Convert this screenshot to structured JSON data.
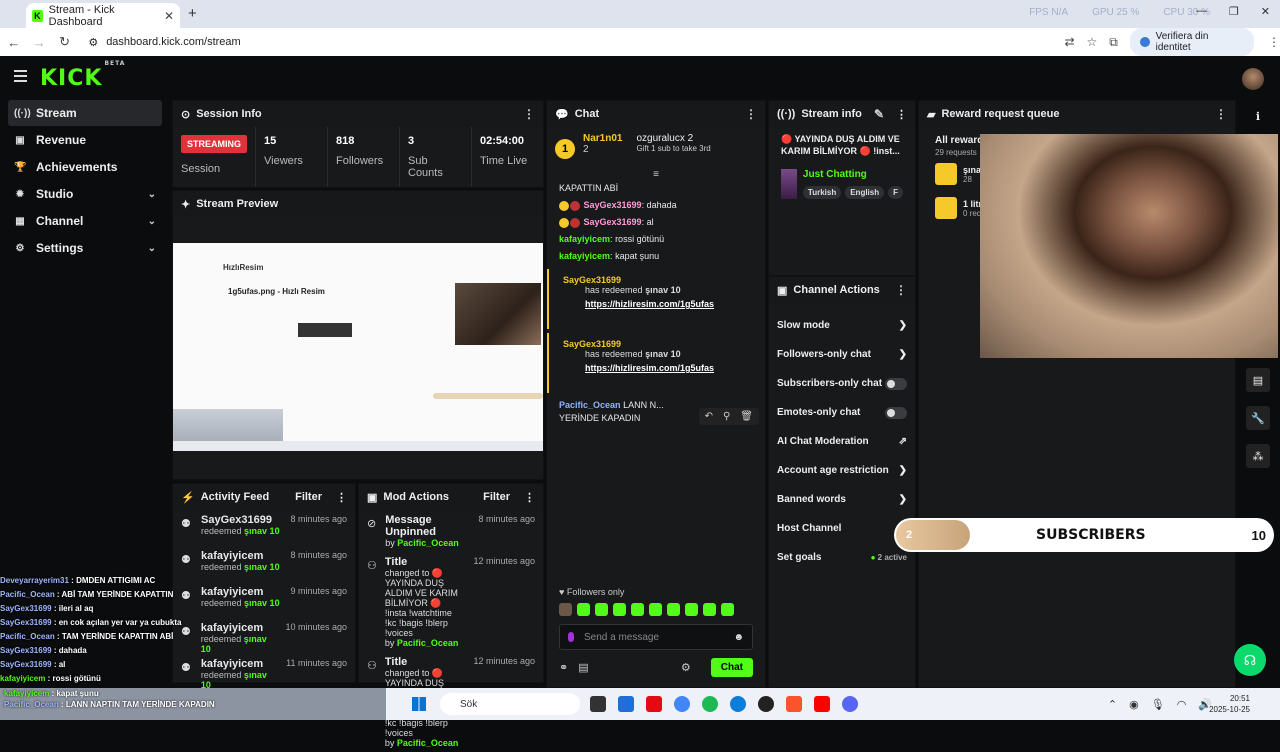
{
  "browser": {
    "tab_title": "Stream - Kick Dashboard",
    "url": "dashboard.kick.com/stream",
    "stats": [
      "FPS N/A",
      "GPU 25 %",
      "CPU 30 %"
    ],
    "profile_label": "Verifiera din identitet"
  },
  "app": {
    "logo": "KICK",
    "logo_tag": "BETA"
  },
  "sidebar": {
    "items": [
      {
        "label": "Stream",
        "icon": "broadcast-icon"
      },
      {
        "label": "Revenue",
        "icon": "wallet-icon"
      },
      {
        "label": "Achievements",
        "icon": "trophy-icon"
      },
      {
        "label": "Studio",
        "icon": "gear-icon"
      },
      {
        "label": "Channel",
        "icon": "grid-icon"
      },
      {
        "label": "Settings",
        "icon": "gear-icon"
      }
    ]
  },
  "session": {
    "title": "Session Info",
    "status": "STREAMING",
    "status_label": "Session",
    "viewers": {
      "value": "15",
      "label": "Viewers"
    },
    "followers": {
      "value": "818",
      "label": "Followers"
    },
    "subs": {
      "value": "3",
      "label": "Sub Counts"
    },
    "time": {
      "value": "02:54:00",
      "label": "Time Live"
    }
  },
  "preview": {
    "title": "Stream Preview",
    "site": "HızlıResim",
    "page_title": "1g5ufas.png - Hızlı Resim"
  },
  "activity": {
    "title": "Activity Feed",
    "filter": "Filter",
    "items": [
      {
        "name": "SayGex31699",
        "action": "redeemed",
        "reward": "şınav 10",
        "time": "8 minutes ago"
      },
      {
        "name": "kafayiyicem",
        "action": "redeemed",
        "reward": "şınav 10",
        "time": "8 minutes ago"
      },
      {
        "name": "kafayiyicem",
        "action": "redeemed",
        "reward": "şınav 10",
        "time": "9 minutes ago"
      },
      {
        "name": "kafayiyicem",
        "action": "redeemed",
        "reward": "şınav 10",
        "time": "10 minutes ago"
      },
      {
        "name": "kafayiyicem",
        "action": "redeemed",
        "reward": "şınav 10",
        "time": "11 minutes ago"
      }
    ]
  },
  "mod": {
    "title": "Mod Actions",
    "filter": "Filter",
    "items": [
      {
        "title": "Message Unpinned",
        "time": "8 minutes ago",
        "text": "",
        "by": "Pacific_Ocean"
      },
      {
        "title": "Title",
        "time": "12 minutes ago",
        "text": "changed to 🔴 YAYINDA DUŞ ALDIM VE KARIM BİLMİYOR 🔴 !insta !watchtime !kc !bagis !blerp !voices",
        "by": "Pacific_Ocean"
      },
      {
        "title": "Title",
        "time": "12 minutes ago",
        "text": "changed to 🔴 YAYINDA DUŞ ALDIM VE NARİN BİLMİYOR 🔴 !insta !watchtime !kc !bagis !blerp !voices",
        "by": "Pacific_Ocean"
      }
    ]
  },
  "chat": {
    "title": "Chat",
    "pinned": {
      "rank": "1",
      "name": "Nar1n01",
      "count": "2",
      "gifter": "ozguralucx",
      "gifter_count": "2",
      "gift_text": "Gift 1 sub to take 3rd"
    },
    "lines": [
      {
        "name": "",
        "text": "KAPATTIN ABİ"
      },
      {
        "name": "SayGex31699",
        "text": "dahada"
      },
      {
        "name": "SayGex31699",
        "text": "al"
      },
      {
        "name": "kafayiyicem",
        "text": "rossi götünü"
      },
      {
        "name": "kafayiyicem",
        "text": "kapat şunu"
      }
    ],
    "redeems": [
      {
        "name": "SayGex31699",
        "label": "has redeemed",
        "reward": "şınav 10",
        "link": "https://hizliresim.com/1g5ufas"
      },
      {
        "name": "SayGex31699",
        "label": "has redeemed",
        "reward": "şınav 10",
        "link": "https://hizliresim.com/1g5ufas"
      },
      {
        "name": "SayGex31699",
        "label": "has redeemed",
        "reward": "şınav 10",
        "link": "https://hizliresim.com/1g5ufas"
      },
      {
        "name": "SayGex31699",
        "label": "has redeemed",
        "reward": "şınav 10",
        "link": "https://hizliresim.com/1g5ufas"
      }
    ],
    "pacific": {
      "name": "Pacific_Ocean",
      "text": "LANN N...",
      "text2": "YERİNDE KAPADIN"
    },
    "followers_only": "Followers only",
    "placeholder": "Send a message",
    "send": "Chat"
  },
  "stream_info": {
    "title": "Stream info",
    "stream_title": "🔴 YAYINDA DUŞ ALDIM VE KARIM BİLMİYOR 🔴 !inst...",
    "category": "Just Chatting",
    "tags": [
      "Turkish",
      "English",
      "F"
    ]
  },
  "channel_actions": {
    "title": "Channel Actions",
    "items": [
      {
        "label": "Slow mode",
        "type": "arrow"
      },
      {
        "label": "Followers-only chat",
        "type": "arrow"
      },
      {
        "label": "Subscribers-only chat",
        "type": "toggle"
      },
      {
        "label": "Emotes-only chat",
        "type": "toggle"
      },
      {
        "label": "AI Chat Moderation",
        "type": "link"
      },
      {
        "label": "Account age restriction",
        "type": "arrow"
      },
      {
        "label": "Banned words",
        "type": "arrow"
      },
      {
        "label": "Host Channel",
        "type": "none"
      },
      {
        "label": "Set goals",
        "type": "active",
        "extra": "2 active"
      }
    ]
  },
  "reward_queue": {
    "title": "Reward request queue",
    "all": "All rewards",
    "all_sub": "29 requests",
    "items": [
      {
        "title": "şınav",
        "count": "28"
      },
      {
        "title": "1 litre",
        "count": "0 req"
      }
    ]
  },
  "overlay": {
    "sub_value": "2",
    "label": "SUBSCRIBERS",
    "goal": "10"
  },
  "obs_chat": [
    {
      "name": "Deveyarrayerim31",
      "text": "DMDEN ATTIGIMI AC"
    },
    {
      "name": "Pacific_Ocean",
      "text": "ABİ TAM YERİNDE KAPATTIN"
    },
    {
      "name": "SayGex31699",
      "text": "ileri al aq"
    },
    {
      "name": "SayGex31699",
      "text": "en cok açılan yer var ya cubukta"
    },
    {
      "name": "Pacific_Ocean",
      "text": "TAM YERİNDE KAPATTIN ABİ"
    },
    {
      "name": "SayGex31699",
      "text": "dahada"
    },
    {
      "name": "SayGex31699",
      "text": "al"
    },
    {
      "name": "kafayiyicem",
      "text": "rossi götünü"
    },
    {
      "name": "kafayiyicem",
      "text": "kapat şunu"
    },
    {
      "name": "Pacific_Ocean",
      "text": "LANN NAPTIN TAM YERİNDE KAPADIN"
    }
  ],
  "taskbar": {
    "search": "Sök",
    "time": "20:51",
    "date": "2025-10-25"
  }
}
